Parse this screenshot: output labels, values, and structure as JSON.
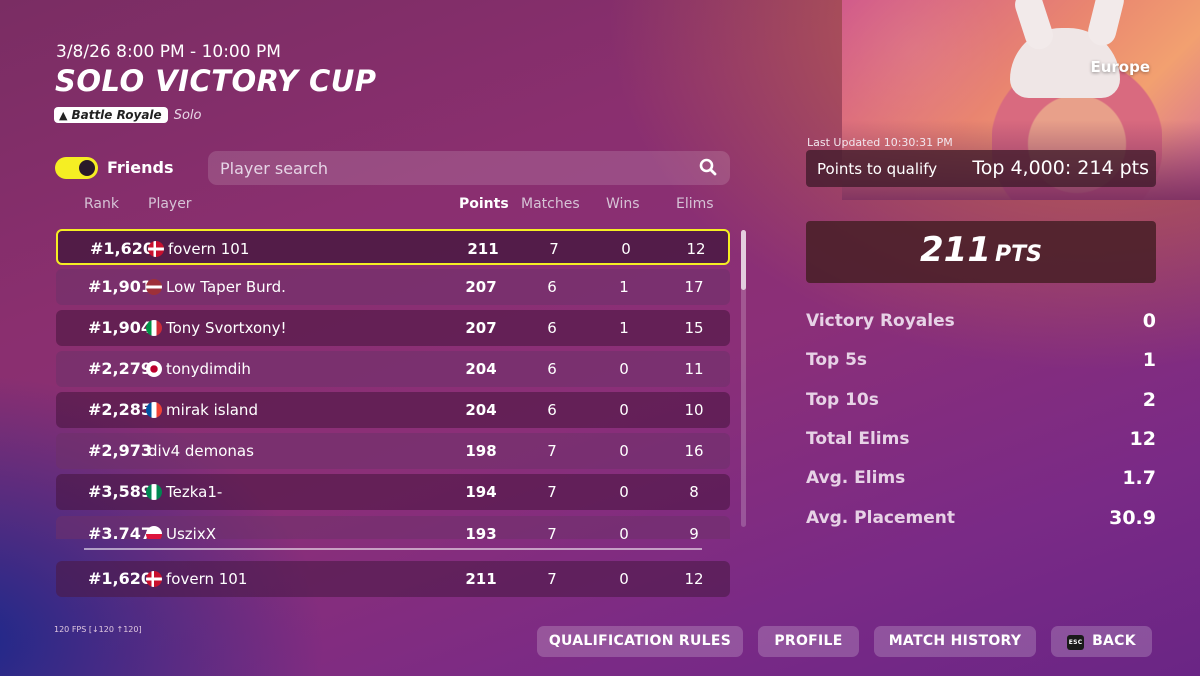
{
  "event": {
    "time": "3/8/26 8:00 PM - 10:00 PM",
    "title": "SOLO VICTORY CUP",
    "mode_badge": "Battle Royale",
    "mode_type": "Solo",
    "region": "Europe"
  },
  "filters": {
    "friends_label": "Friends",
    "friends_toggle_on": true,
    "search_placeholder": "Player search"
  },
  "columns": {
    "rank": "Rank",
    "player": "Player",
    "points": "Points",
    "matches": "Matches",
    "wins": "Wins",
    "elims": "Elims"
  },
  "rows": [
    {
      "rank": "#1,620",
      "flag": "dk",
      "name": "fovern 101",
      "points": "211",
      "matches": "7",
      "wins": "0",
      "elims": "12",
      "highlight": true
    },
    {
      "rank": "#1,901",
      "flag": "lv",
      "name": "Low Taper Burd.",
      "points": "207",
      "matches": "6",
      "wins": "1",
      "elims": "17"
    },
    {
      "rank": "#1,904",
      "flag": "it",
      "name": "Tony Svortxony!",
      "points": "207",
      "matches": "6",
      "wins": "1",
      "elims": "15"
    },
    {
      "rank": "#2,279",
      "flag": "jp",
      "name": "tonydimdih",
      "points": "204",
      "matches": "6",
      "wins": "0",
      "elims": "11"
    },
    {
      "rank": "#2,285",
      "flag": "fr",
      "name": "mirak island",
      "points": "204",
      "matches": "6",
      "wins": "0",
      "elims": "10"
    },
    {
      "rank": "#2,973",
      "flag": "none",
      "name": "div4 demonas",
      "points": "198",
      "matches": "7",
      "wins": "0",
      "elims": "16"
    },
    {
      "rank": "#3,589",
      "flag": "ng",
      "name": "Tezka1-",
      "points": "194",
      "matches": "7",
      "wins": "0",
      "elims": "8"
    },
    {
      "rank": "#3,747",
      "flag": "pl",
      "name": "UszixX",
      "points": "193",
      "matches": "7",
      "wins": "0",
      "elims": "9"
    }
  ],
  "self_row": {
    "rank": "#1,620",
    "flag": "dk",
    "name": "fovern 101",
    "points": "211",
    "matches": "7",
    "wins": "0",
    "elims": "12"
  },
  "summary": {
    "last_updated": "Last Updated 10:30:31 PM",
    "qualify_label": "Points to qualify",
    "qualify_value": "Top 4,000: 214 pts",
    "total_points": "211",
    "points_unit": "PTS"
  },
  "stats": [
    {
      "label": "Victory Royales",
      "value": "0"
    },
    {
      "label": "Top 5s",
      "value": "1"
    },
    {
      "label": "Top 10s",
      "value": "2"
    },
    {
      "label": "Total Elims",
      "value": "12"
    },
    {
      "label": "Avg. Elims",
      "value": "1.7"
    },
    {
      "label": "Avg. Placement",
      "value": "30.9"
    }
  ],
  "fps": "120 FPS [↓120 ↑120]",
  "buttons": {
    "qualification_rules": "QUALIFICATION RULES",
    "profile": "PROFILE",
    "match_history": "MATCH HISTORY",
    "back": "BACK",
    "esc_key": "ESC"
  },
  "colors": {
    "accent_yellow": "#f5ee23",
    "background": "#8a2f6f"
  }
}
